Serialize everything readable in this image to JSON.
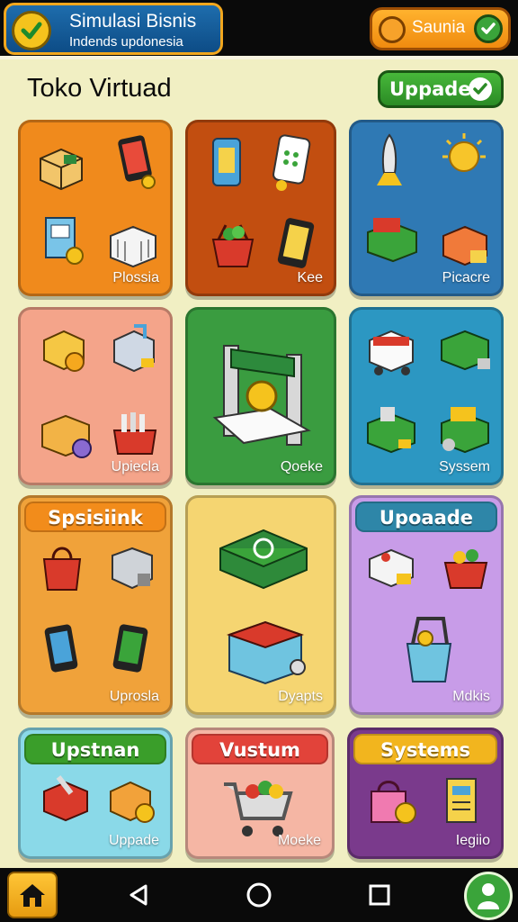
{
  "header": {
    "app_title": "Simulasi Bisnis",
    "app_subtitle": "Indends updonesia",
    "status_label": "Saunia"
  },
  "store": {
    "title": "Toko Virtuad",
    "update_button": "Uppade"
  },
  "cards": [
    {
      "label": "Plossia",
      "color": "#f08a1c",
      "icons": [
        "box-icon",
        "tablet-icon",
        "cabinet-icon",
        "crate-icon"
      ]
    },
    {
      "label": "Kee",
      "color": "#c24e10",
      "icons": [
        "phone-icon",
        "calculator-icon",
        "basket-icon",
        "tablet-icon"
      ]
    },
    {
      "label": "Picacre",
      "color": "#2f79b4",
      "icons": [
        "rocket-icon",
        "lightbulb-icon",
        "market-stall-icon",
        "storefront-icon"
      ]
    },
    {
      "label": "Upiecla",
      "color": "#f4a48a",
      "icons": [
        "coin-box-icon",
        "machine-icon",
        "package-icon",
        "basket-icon"
      ]
    },
    {
      "label": "Qoeke",
      "color": "#3a9c40",
      "icons": [
        "printer-gate-icon"
      ]
    },
    {
      "label": "Syssem",
      "color": "#2c97c2",
      "icons": [
        "food-cart-icon",
        "counter-icon",
        "drawer-icon",
        "stall-icon"
      ]
    },
    {
      "label": "Uprosla",
      "banner": "Spsisiink",
      "banner_color": "#f28c1b",
      "color": "#f0a23a",
      "icons": [
        "bag-icon",
        "machine-icon",
        "phone-icon",
        "tablet-icon"
      ]
    },
    {
      "label": "Dyapts",
      "color": "#f5d571",
      "icons": [
        "payment-terminal-icon",
        "cooler-icon"
      ]
    },
    {
      "label": "Mdkis",
      "banner": "Upoaade",
      "banner_color": "#2e86a8",
      "color": "#c89ce8",
      "icons": [
        "register-icon",
        "basket-icon",
        "bucket-icon"
      ]
    },
    {
      "label": "Uppade",
      "banner": "Upstnan",
      "banner_color": "#3a9e2a",
      "color": "#8ad9e8",
      "icons": [
        "toolbox-icon",
        "coin-box-icon"
      ]
    },
    {
      "label": "Moeke",
      "banner": "Vustum",
      "banner_color": "#e2433a",
      "color": "#f5b6a4",
      "icons": [
        "shopping-cart-icon"
      ]
    },
    {
      "label": "Iegiio",
      "banner": "Systems",
      "banner_color": "#f2b51e",
      "color": "#7a3a8c",
      "icons": [
        "bag-icon",
        "book-icon"
      ]
    }
  ]
}
